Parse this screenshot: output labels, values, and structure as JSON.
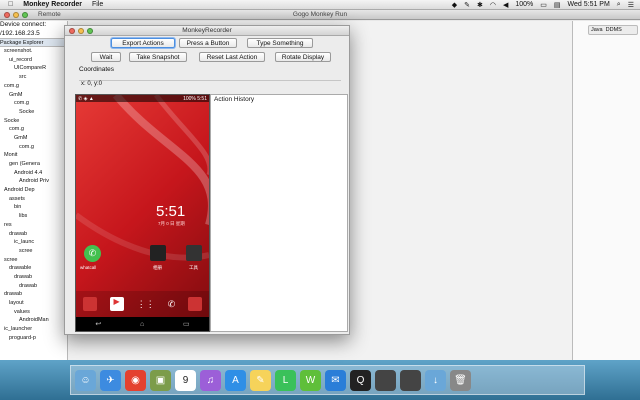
{
  "menubar": {
    "apple": "",
    "app": "Monkey Recorder",
    "file": "File",
    "battery": "100%",
    "clock": "Wed 5:51 PM"
  },
  "eclipse": {
    "title": "Gogo Monkey Run",
    "remote_tab": "Remote",
    "device_connect": "Device connect:",
    "device_ip": "/192.168.23.5",
    "package_explorer": "Package Explorer",
    "tree": [
      "screenshot.",
      "ui_record",
      "UICompareR",
      "src",
      "com.g",
      "GmM",
      "com.g",
      "Socke",
      "Socke",
      "com.g",
      "GmM",
      "com.g",
      "Monit",
      "gen (Genera",
      "Android 4.4",
      "Android Priv",
      "Android Dep",
      "assets",
      "bin",
      "libs",
      "res",
      "drawab",
      "ic_launc",
      "scree",
      "scree",
      "drawable",
      "drawab",
      "drawab",
      "drawab",
      "layout",
      "values",
      "AndroidMan",
      "ic_launcher",
      "proguard-p"
    ],
    "ddms": "DDMS",
    "java": "Java"
  },
  "monkey": {
    "title": "MonkeyRecorder",
    "buttons": {
      "export": "Export Actions",
      "press": "Press a Button",
      "type": "Type Something",
      "wait": "Wait",
      "snapshot": "Take Snapshot",
      "reset": "Reset Last Action",
      "rotate": "Rotate Display"
    },
    "coords_label": "Coordinates",
    "coords_value": "x: 0, y:0",
    "action_history": "Action History",
    "phone": {
      "status_right": "100% 5:51",
      "clock": "5:51",
      "date": "7月 0 日 星期",
      "app_whatsapp": "whatcall",
      "app_2": "相册",
      "app_3": "工具"
    }
  },
  "dock": {
    "icons": [
      "finder-icon",
      "safari-icon",
      "chrome-icon",
      "preview-icon",
      "calendar-icon",
      "itunes-icon",
      "appstore-icon",
      "notes-icon",
      "line-icon",
      "wechat-icon",
      "stamp-icon",
      "qq-icon",
      "window-icon",
      "window-icon",
      "downloads-icon",
      "trash-icon"
    ],
    "calendar_day": "9"
  }
}
